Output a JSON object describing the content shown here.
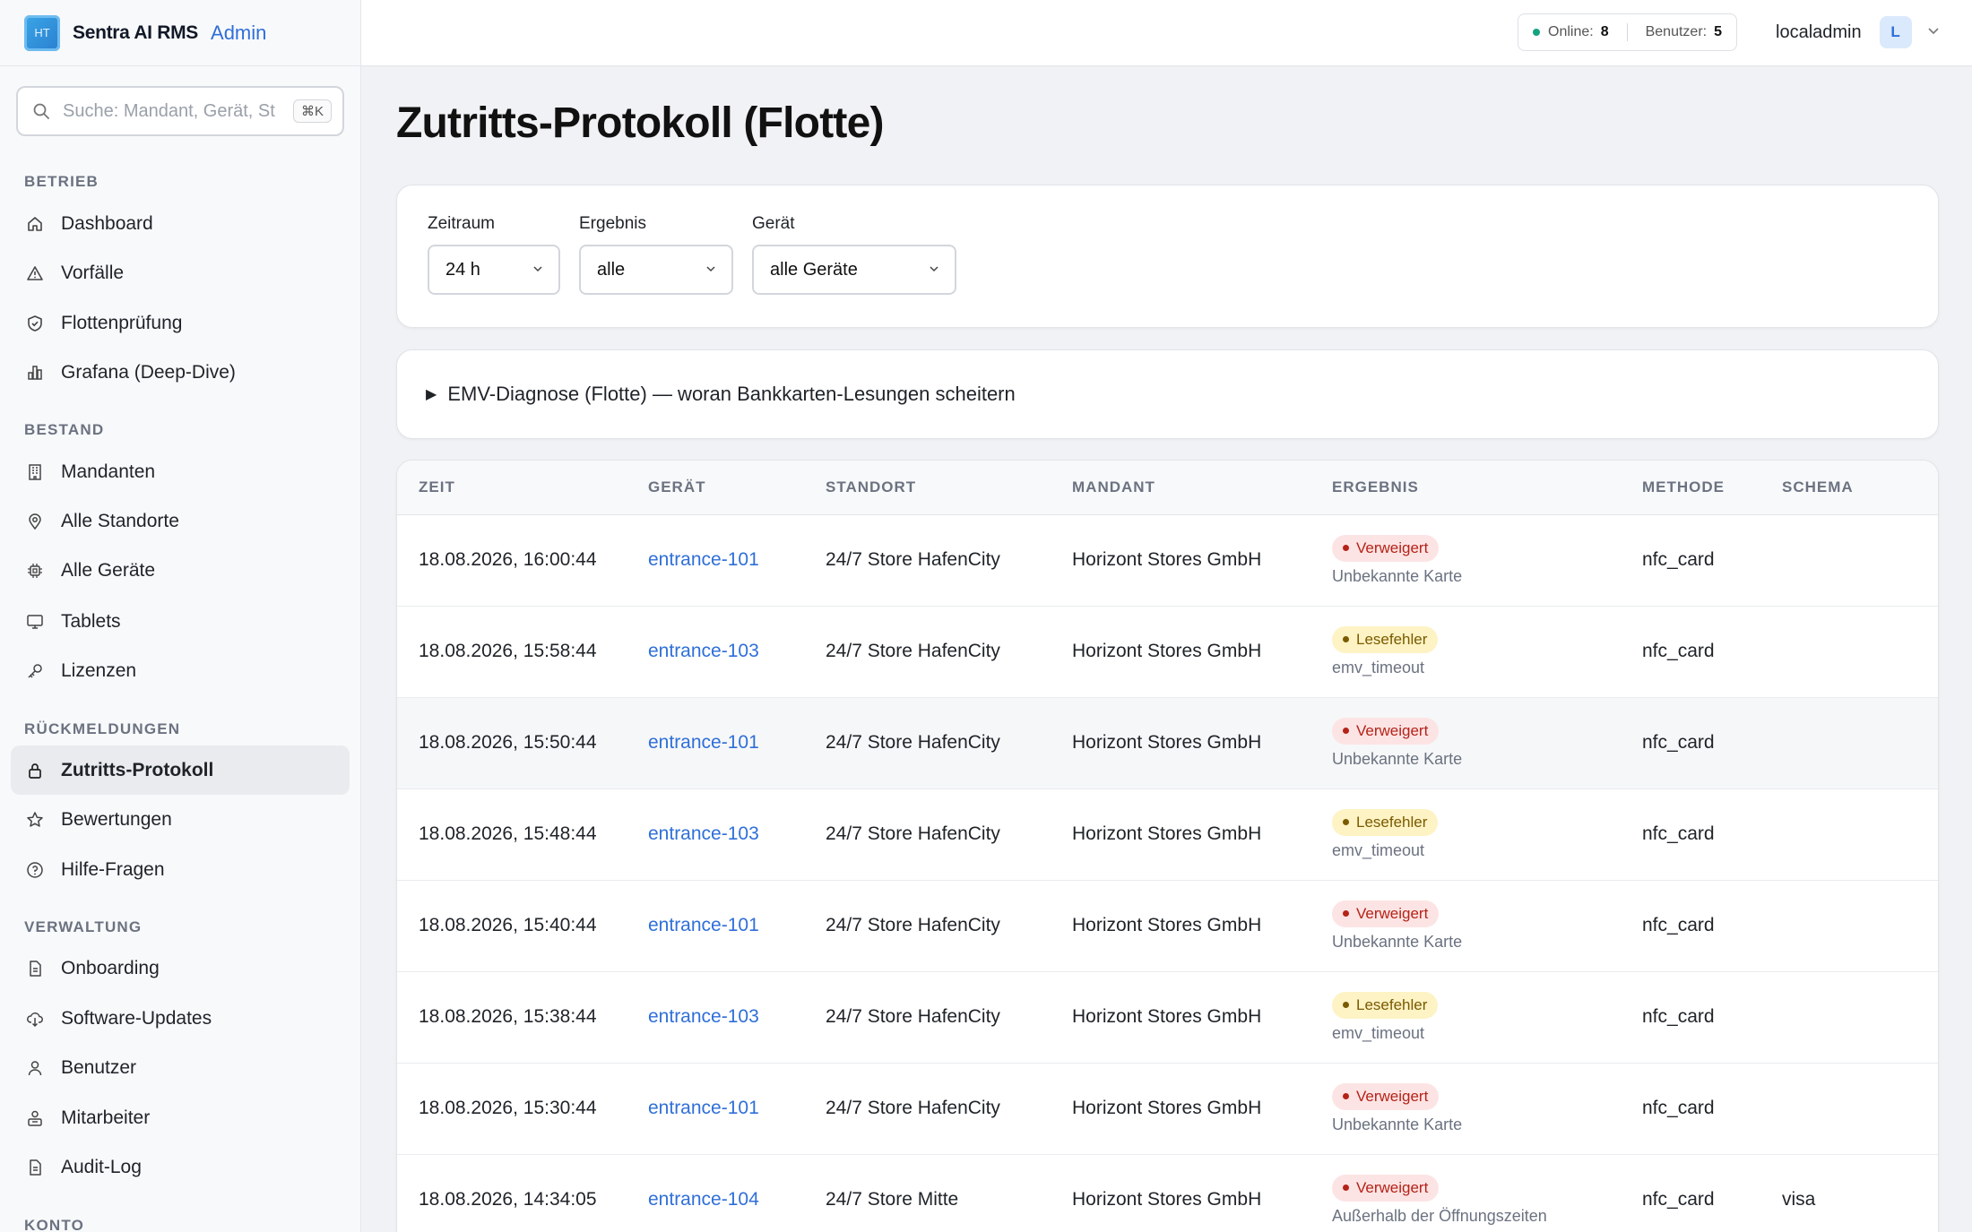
{
  "brand": {
    "logo_text": "HT",
    "name": "Sentra AI RMS",
    "badge": "Admin"
  },
  "search": {
    "placeholder": "Suche: Mandant, Gerät, St",
    "shortcut": "⌘K"
  },
  "sidebar": {
    "sections": [
      {
        "title": "BETRIEB",
        "items": [
          {
            "label": "Dashboard",
            "icon": "home-icon"
          },
          {
            "label": "Vorfälle",
            "icon": "warning-icon"
          },
          {
            "label": "Flottenprüfung",
            "icon": "shield-icon"
          },
          {
            "label": "Grafana (Deep-Dive)",
            "icon": "chart-icon"
          }
        ]
      },
      {
        "title": "BESTAND",
        "items": [
          {
            "label": "Mandanten",
            "icon": "building-icon"
          },
          {
            "label": "Alle Standorte",
            "icon": "pin-icon"
          },
          {
            "label": "Alle Geräte",
            "icon": "cpu-icon"
          },
          {
            "label": "Tablets",
            "icon": "monitor-icon"
          },
          {
            "label": "Lizenzen",
            "icon": "key-icon"
          }
        ]
      },
      {
        "title": "RÜCKMELDUNGEN",
        "items": [
          {
            "label": "Zutritts-Protokoll",
            "icon": "lock-icon",
            "active": true
          },
          {
            "label": "Bewertungen",
            "icon": "star-icon"
          },
          {
            "label": "Hilfe-Fragen",
            "icon": "help-icon"
          }
        ]
      },
      {
        "title": "VERWALTUNG",
        "items": [
          {
            "label": "Onboarding",
            "icon": "document-icon"
          },
          {
            "label": "Software-Updates",
            "icon": "cloud-download-icon"
          },
          {
            "label": "Benutzer",
            "icon": "user-icon"
          },
          {
            "label": "Mitarbeiter",
            "icon": "users-icon"
          },
          {
            "label": "Audit-Log",
            "icon": "document-icon"
          }
        ]
      },
      {
        "title": "KONTO",
        "items": []
      }
    ]
  },
  "topbar": {
    "online_label": "Online:",
    "online_count": "8",
    "users_label": "Benutzer:",
    "users_count": "5",
    "username": "localadmin",
    "avatar_initial": "L"
  },
  "page": {
    "title": "Zutritts-Protokoll (Flotte)"
  },
  "filters": [
    {
      "label": "Zeitraum",
      "value": "24 h"
    },
    {
      "label": "Ergebnis",
      "value": "alle"
    },
    {
      "label": "Gerät",
      "value": "alle Geräte"
    }
  ],
  "emv": {
    "summary": "EMV-Diagnose (Flotte) — woran Bankkarten-Lesungen scheitern"
  },
  "table": {
    "columns": [
      "ZEIT",
      "GERÄT",
      "STANDORT",
      "MANDANT",
      "ERGEBNIS",
      "METHODE",
      "SCHEMA"
    ],
    "rows": [
      {
        "zeit": "18.08.2026, 16:00:44",
        "geraet": "entrance-101",
        "standort": "24/7 Store HafenCity",
        "mandant": "Horizont Stores GmbH",
        "ergebnis": "Verweigert",
        "status": "red",
        "detail": "Unbekannte Karte",
        "methode": "nfc_card",
        "schema": ""
      },
      {
        "zeit": "18.08.2026, 15:58:44",
        "geraet": "entrance-103",
        "standort": "24/7 Store HafenCity",
        "mandant": "Horizont Stores GmbH",
        "ergebnis": "Lesefehler",
        "status": "yel",
        "detail": "emv_timeout",
        "methode": "nfc_card",
        "schema": ""
      },
      {
        "zeit": "18.08.2026, 15:50:44",
        "geraet": "entrance-101",
        "standort": "24/7 Store HafenCity",
        "mandant": "Horizont Stores GmbH",
        "ergebnis": "Verweigert",
        "status": "red",
        "detail": "Unbekannte Karte",
        "methode": "nfc_card",
        "schema": ""
      },
      {
        "zeit": "18.08.2026, 15:48:44",
        "geraet": "entrance-103",
        "standort": "24/7 Store HafenCity",
        "mandant": "Horizont Stores GmbH",
        "ergebnis": "Lesefehler",
        "status": "yel",
        "detail": "emv_timeout",
        "methode": "nfc_card",
        "schema": ""
      },
      {
        "zeit": "18.08.2026, 15:40:44",
        "geraet": "entrance-101",
        "standort": "24/7 Store HafenCity",
        "mandant": "Horizont Stores GmbH",
        "ergebnis": "Verweigert",
        "status": "red",
        "detail": "Unbekannte Karte",
        "methode": "nfc_card",
        "schema": ""
      },
      {
        "zeit": "18.08.2026, 15:38:44",
        "geraet": "entrance-103",
        "standort": "24/7 Store HafenCity",
        "mandant": "Horizont Stores GmbH",
        "ergebnis": "Lesefehler",
        "status": "yel",
        "detail": "emv_timeout",
        "methode": "nfc_card",
        "schema": ""
      },
      {
        "zeit": "18.08.2026, 15:30:44",
        "geraet": "entrance-101",
        "standort": "24/7 Store HafenCity",
        "mandant": "Horizont Stores GmbH",
        "ergebnis": "Verweigert",
        "status": "red",
        "detail": "Unbekannte Karte",
        "methode": "nfc_card",
        "schema": ""
      },
      {
        "zeit": "18.08.2026, 14:34:05",
        "geraet": "entrance-104",
        "standort": "24/7 Store Mitte",
        "mandant": "Horizont Stores GmbH",
        "ergebnis": "Verweigert",
        "status": "red",
        "detail": "Außerhalb der Öffnungszeiten",
        "methode": "nfc_card",
        "schema": "visa"
      }
    ]
  },
  "colors": {
    "accent": "#2f6fd8",
    "online": "#14a37f",
    "denied": "#b42318",
    "read_error": "#7a5a00"
  }
}
